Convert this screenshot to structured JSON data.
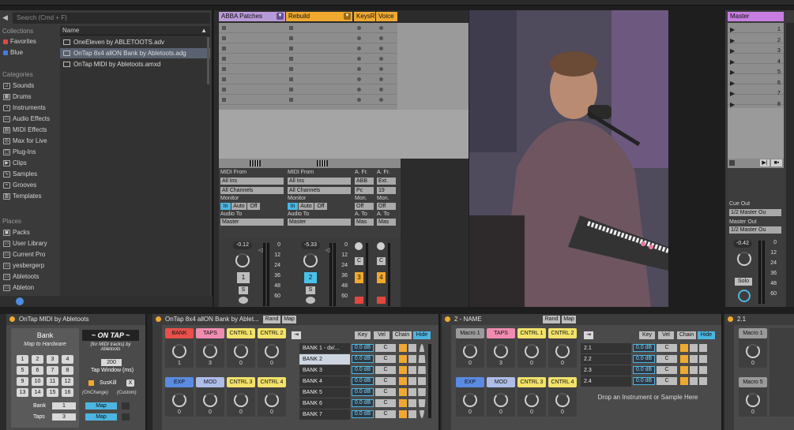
{
  "browser": {
    "search_placeholder": "Search (Cmd + F)",
    "collections_title": "Collections",
    "collections": [
      "Favorites",
      "Blue"
    ],
    "categories_title": "Categories",
    "categories": [
      "Sounds",
      "Drums",
      "Instruments",
      "Audio Effects",
      "MIDI Effects",
      "Max for Live",
      "Plug-Ins",
      "Clips",
      "Samples",
      "Grooves",
      "Templates"
    ],
    "places_title": "Places",
    "places": [
      "Packs",
      "User Library",
      "Current Pro",
      "yesbergerp",
      "Abletoots",
      "Ableton"
    ],
    "name_header": "Name",
    "files": [
      {
        "name": "OneEleven by ABLETOOTS.adv",
        "selected": false
      },
      {
        "name": "OnTap 8x4 allON Bank by Abletoots.adg",
        "selected": true
      },
      {
        "name": "OnTap MIDI by Abletoots.amxd",
        "selected": false
      }
    ]
  },
  "tracks": [
    {
      "name": "ABBA Patches",
      "color": "#b99ad8",
      "midi_from": "All Ins",
      "channel": "All Channels",
      "audio_to": "Master",
      "volume": "-0.12",
      "number": "1",
      "num_state": "off"
    },
    {
      "name": "Rebuild",
      "color": "#f0a92e",
      "midi_from": "All Ins",
      "channel": "All Channels",
      "audio_to": "Master",
      "volume": "-5.33",
      "number": "2",
      "num_state": "on"
    },
    {
      "name": "KeysR",
      "color": "#f0a92e",
      "midi_from": "ABB",
      "channel": "Pc",
      "audio_to": "Mas",
      "volume": "",
      "number": "3",
      "num_state": "y"
    },
    {
      "name": "Voice",
      "color": "#f0a92e",
      "midi_from": "Ext.",
      "channel": "19",
      "audio_to": "Mas",
      "volume": "",
      "number": "4",
      "num_state": "y"
    }
  ],
  "io_labels": {
    "midi_from": "MIDI From",
    "monitor": "Monitor",
    "in": "In",
    "auto": "Auto",
    "off": "Off",
    "audio_to": "Audio To",
    "a_fr": "A. Fr.",
    "mon": "Mon.",
    "a_to": "A. To"
  },
  "meter_scale": [
    "0",
    "12",
    "24",
    "36",
    "48",
    "60"
  ],
  "master": {
    "name": "Master",
    "slots": [
      "1",
      "2",
      "3",
      "4",
      "5",
      "6",
      "7",
      "8"
    ],
    "cue_out_label": "Cue Out",
    "cue_out": "1/2 Master Ou",
    "master_out_label": "Master Out",
    "master_out": "1/2 Master Ou",
    "volume": "-0.42",
    "solo": "Solo"
  },
  "devices": {
    "ontap_midi": {
      "title": "OnTap MIDI by Abletoots",
      "bank_title": "Bank",
      "bank_sub": "Map to Hardware",
      "grid": [
        "1",
        "2",
        "3",
        "4",
        "5",
        "6",
        "7",
        "8",
        "9",
        "10",
        "11",
        "12",
        "13",
        "14",
        "15",
        "16"
      ],
      "logo": "~ ON TAP ~",
      "logo_sub": "(for MIDI tracks) by Abletoots",
      "tap_value": "200",
      "tap_window": "Tap Window (ms)",
      "suskill": "SusKill",
      "x": "X",
      "onchange": "(OnChange)",
      "custom": "(Custom)",
      "bank_label": "Bank",
      "bank_value": "1",
      "taps_label": "Taps",
      "taps_value": "3",
      "map": "Map"
    },
    "rack": {
      "title": "OnTap 8x4 allON Bank by Ablet...",
      "rand": "Rand",
      "map": "Map",
      "macros": [
        {
          "label": "BANK",
          "color": "#e8504a",
          "value": "1"
        },
        {
          "label": "TAPS",
          "color": "#f08cb0",
          "value": "3"
        },
        {
          "label": "CNTRL 1",
          "color": "#f2e26a",
          "value": "0"
        },
        {
          "label": "CNTRL 2",
          "color": "#f2e26a",
          "value": "0"
        },
        {
          "label": "EXP",
          "color": "#5a8be0",
          "value": "0"
        },
        {
          "label": "MOD",
          "color": "#aebde8",
          "value": "0"
        },
        {
          "label": "CNTRL 3",
          "color": "#f2e26a",
          "value": "0"
        },
        {
          "label": "CNTRL 4",
          "color": "#f2e26a",
          "value": "0"
        }
      ],
      "chain_headers": [
        "Key",
        "Vel",
        "Chain",
        "Hide"
      ],
      "chains": [
        {
          "name": "BANK 1 - dx/...",
          "db": "0.0 dB",
          "pan": "C",
          "selected": false
        },
        {
          "name": "BANK 2",
          "db": "0.0 dB",
          "pan": "C",
          "selected": true
        },
        {
          "name": "BANK 3",
          "db": "0.0 dB",
          "pan": "C",
          "selected": false
        },
        {
          "name": "BANK 4",
          "db": "0.0 dB",
          "pan": "C",
          "selected": false
        },
        {
          "name": "BANK 5",
          "db": "0.0 dB",
          "pan": "C",
          "selected": false
        },
        {
          "name": "BANK 6",
          "db": "0.0 dB",
          "pan": "C",
          "selected": false
        },
        {
          "name": "BANK 7",
          "db": "0.0 dB",
          "pan": "C",
          "selected": false
        }
      ],
      "s": "S"
    },
    "rack2": {
      "title": "2 - NAME",
      "rand": "Rand",
      "map": "Map",
      "macros": [
        {
          "label": "Macro 1",
          "color": "#9a9a9a",
          "value": "0"
        },
        {
          "label": "TAPS",
          "color": "#f08cb0",
          "value": "3"
        },
        {
          "label": "CNTRL 1",
          "color": "#f2e26a",
          "value": "0"
        },
        {
          "label": "CNTRL 2",
          "color": "#f2e26a",
          "value": "0"
        },
        {
          "label": "EXP",
          "color": "#5a8be0",
          "value": "0"
        },
        {
          "label": "MOD",
          "color": "#aebde8",
          "value": "0"
        },
        {
          "label": "CNTRL 3",
          "color": "#f2e26a",
          "value": "0"
        },
        {
          "label": "CNTRL 4",
          "color": "#f2e26a",
          "value": "0"
        }
      ],
      "chain_headers": [
        "Key",
        "Vel",
        "Chain",
        "Hide"
      ],
      "chains": [
        {
          "name": "2.1",
          "db": "0.0 dB",
          "pan": "C"
        },
        {
          "name": "2.2",
          "db": "0.0 dB",
          "pan": "C"
        },
        {
          "name": "2.3",
          "db": "0.0 dB",
          "pan": "C"
        },
        {
          "name": "2.4",
          "db": "0.0 dB",
          "pan": "C"
        }
      ],
      "drop_text": "Drop an Instrument or Sample Here",
      "s": "S"
    },
    "rack3": {
      "title": "2.1",
      "macros": [
        {
          "label": "Macro 1",
          "value": "0"
        },
        {
          "label": "Macro 5",
          "value": "0"
        }
      ]
    }
  }
}
